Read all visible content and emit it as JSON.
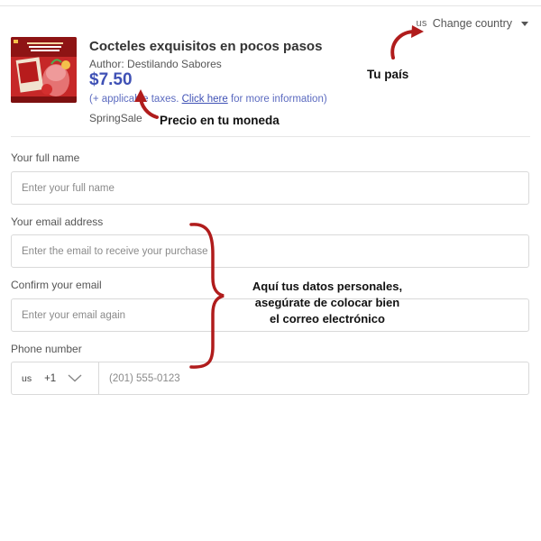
{
  "header": {
    "country_code": "us",
    "change_country_label": "Change country"
  },
  "product": {
    "cover_text_top": "COCTELES EXQUISITOS EN POCOS PASOS",
    "title": "Cocteles exquisitos en pocos pasos",
    "author": "Author: Destilando Sabores",
    "price": "$7.50",
    "tax_prefix": "(+ applicable taxes. ",
    "tax_link": "Click here",
    "tax_suffix": " for more information)",
    "promo": "SpringSale"
  },
  "form": {
    "name": {
      "label": "Your full name",
      "placeholder": "Enter your full name"
    },
    "email": {
      "label": "Your email address",
      "placeholder": "Enter the email to receive your purchase"
    },
    "confirm_email": {
      "label": "Confirm your email",
      "placeholder": "Enter your email again"
    },
    "phone": {
      "label": "Phone number",
      "country_code": "us",
      "dial_code": "+1",
      "placeholder": "(201) 555-0123"
    }
  },
  "annotations": {
    "country_note": "Tu país",
    "price_note": "Precio en tu moneda",
    "personal_note_lines": [
      "Aquí tus datos personales,",
      "asegúrate de colocar bien",
      "el correo electrónico"
    ],
    "color": "#b01c1c"
  },
  "colors": {
    "price": "#3f51b5",
    "link": "#3f51b5",
    "border": "#d9d9d9",
    "annotation_red": "#b01c1c"
  }
}
